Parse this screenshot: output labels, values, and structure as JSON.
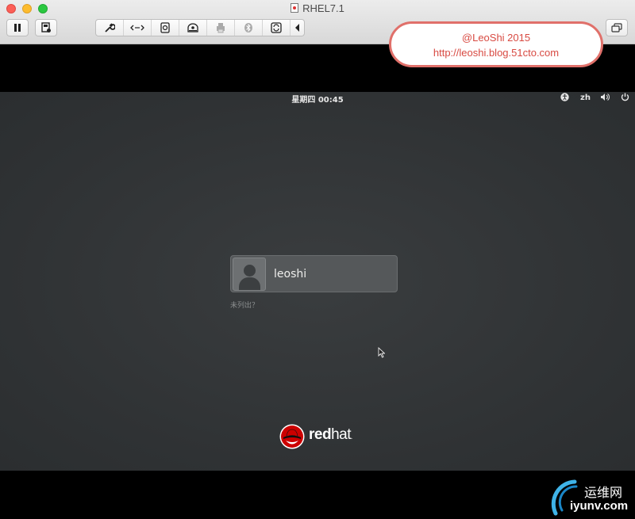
{
  "window": {
    "title": "RHEL7.1"
  },
  "toolbar": {
    "pause_icon": "pause-icon",
    "snapshot_icon": "snapshot-icon",
    "tools": [
      "wrench-icon",
      "network-icon",
      "disk-icon",
      "cdrom-icon",
      "printer-icon",
      "bluetooth-icon",
      "usb-sync-icon"
    ],
    "more_icon": "chevron-left-icon",
    "fullscreen_icon": "restore-window-icon"
  },
  "watermark": {
    "line1": "@LeoShi 2015",
    "line2": "http://leoshi.blog.51cto.com"
  },
  "gnome": {
    "clock": "星期四 00:45",
    "tray": {
      "accessibility_icon": "accessibility-icon",
      "language": "zh",
      "volume_icon": "volume-icon",
      "power_icon": "power-icon"
    },
    "login": {
      "username": "leoshi",
      "not_listed": "未列出？"
    },
    "branding": {
      "word_bold": "red",
      "word_light": "hat",
      "trademark": "."
    }
  },
  "site_badge": {
    "cn": "运维网",
    "en": "iyunv.com"
  },
  "colors": {
    "accent_watermark": "#d84a42",
    "gdm_background": "#2f3234",
    "redhat_red": "#cc0000"
  }
}
